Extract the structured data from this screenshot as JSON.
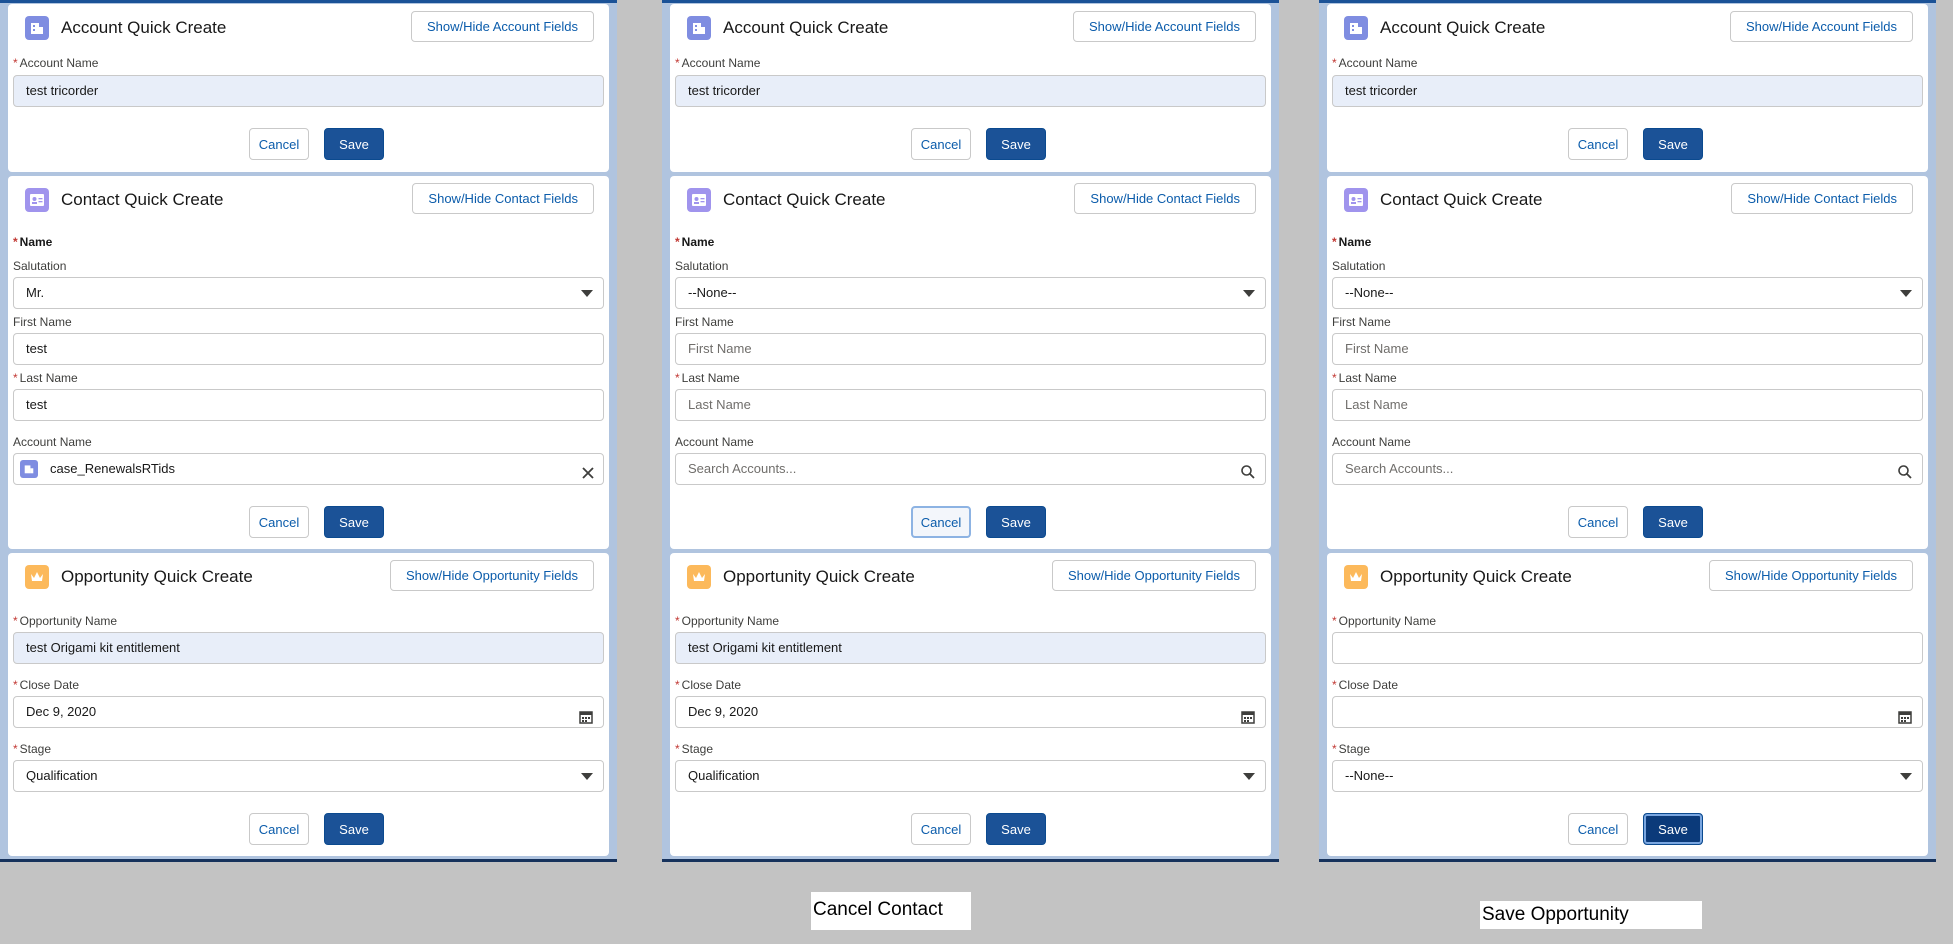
{
  "panels": [
    {
      "account": {
        "title": "Account Quick Create",
        "toggle": "Show/Hide Account Fields",
        "account_name_label": "Account Name",
        "account_name_value": "test tricorder",
        "cancel": "Cancel",
        "save": "Save"
      },
      "contact": {
        "title": "Contact Quick Create",
        "toggle": "Show/Hide Contact Fields",
        "name_label": "Name",
        "salutation_label": "Salutation",
        "salutation_value": "Mr.",
        "first_name_label": "First Name",
        "first_name_value": "test",
        "last_name_label": "Last Name",
        "last_name_value": "test",
        "account_name_label": "Account Name",
        "account_name_value": "case_RenewalsRTids",
        "cancel": "Cancel",
        "save": "Save"
      },
      "opportunity": {
        "title": "Opportunity Quick Create",
        "toggle": "Show/Hide Opportunity Fields",
        "opp_name_label": "Opportunity Name",
        "opp_name_value": "test Origami kit entitlement",
        "close_date_label": "Close Date",
        "close_date_value": "Dec 9, 2020",
        "stage_label": "Stage",
        "stage_value": "Qualification",
        "cancel": "Cancel",
        "save": "Save"
      }
    },
    {
      "account": {
        "title": "Account Quick Create",
        "toggle": "Show/Hide Account Fields",
        "account_name_label": "Account Name",
        "account_name_value": "test tricorder",
        "cancel": "Cancel",
        "save": "Save"
      },
      "contact": {
        "title": "Contact Quick Create",
        "toggle": "Show/Hide Contact Fields",
        "name_label": "Name",
        "salutation_label": "Salutation",
        "salutation_value": "--None--",
        "first_name_label": "First Name",
        "first_name_placeholder": "First Name",
        "last_name_label": "Last Name",
        "last_name_placeholder": "Last Name",
        "account_name_label": "Account Name",
        "account_search_placeholder": "Search Accounts...",
        "cancel": "Cancel",
        "save": "Save"
      },
      "opportunity": {
        "title": "Opportunity Quick Create",
        "toggle": "Show/Hide Opportunity Fields",
        "opp_name_label": "Opportunity Name",
        "opp_name_value": "test Origami kit entitlement",
        "close_date_label": "Close Date",
        "close_date_value": "Dec 9, 2020",
        "stage_label": "Stage",
        "stage_value": "Qualification",
        "cancel": "Cancel",
        "save": "Save"
      }
    },
    {
      "account": {
        "title": "Account Quick Create",
        "toggle": "Show/Hide Account Fields",
        "account_name_label": "Account Name",
        "account_name_value": "test tricorder",
        "cancel": "Cancel",
        "save": "Save"
      },
      "contact": {
        "title": "Contact Quick Create",
        "toggle": "Show/Hide Contact Fields",
        "name_label": "Name",
        "salutation_label": "Salutation",
        "salutation_value": "--None--",
        "first_name_label": "First Name",
        "first_name_placeholder": "First Name",
        "last_name_label": "Last Name",
        "last_name_placeholder": "Last Name",
        "account_name_label": "Account Name",
        "account_search_placeholder": "Search Accounts...",
        "cancel": "Cancel",
        "save": "Save"
      },
      "opportunity": {
        "title": "Opportunity Quick Create",
        "toggle": "Show/Hide Opportunity Fields",
        "opp_name_label": "Opportunity Name",
        "close_date_label": "Close Date",
        "stage_label": "Stage",
        "stage_value": "--None--",
        "cancel": "Cancel",
        "save": "Save"
      }
    }
  ],
  "captions": {
    "cancel_contact": "Cancel Contact",
    "save_opportunity": "Save Opportunity"
  },
  "colors": {
    "brand": "#1b5297",
    "account_icon": "#7f8de1",
    "contact_icon": "#a094ed",
    "opportunity_icon": "#fcb95b",
    "required": "#c23934"
  }
}
